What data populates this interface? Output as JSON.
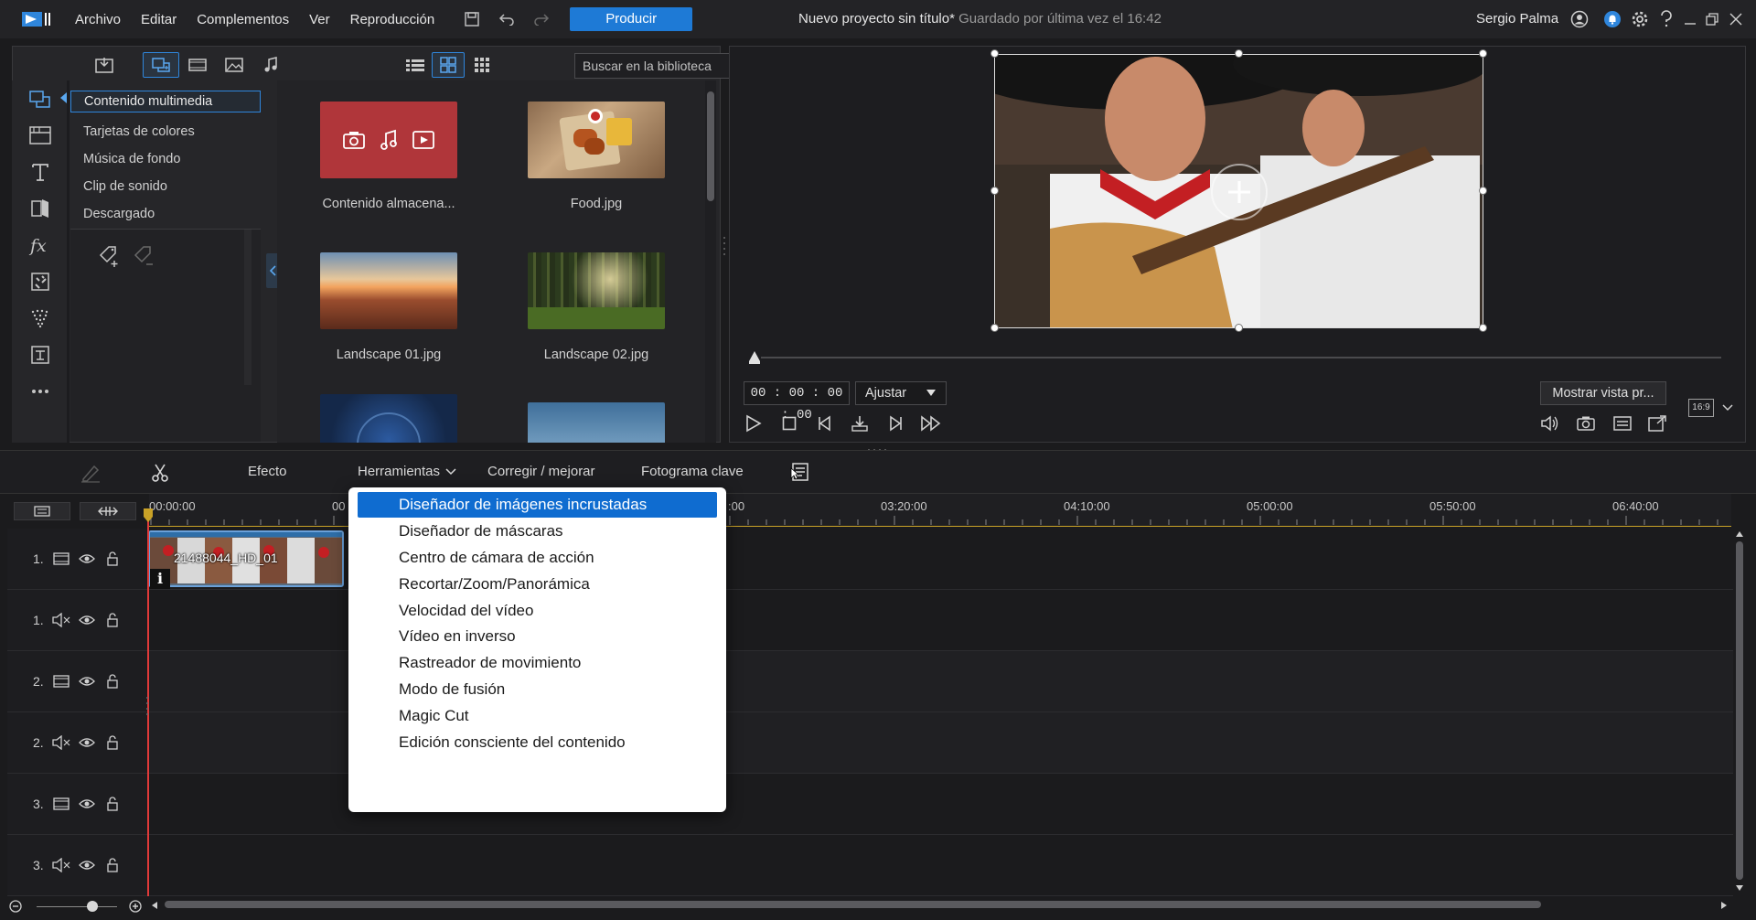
{
  "app": {
    "menu": [
      "Archivo",
      "Editar",
      "Complementos",
      "Ver",
      "Reproducción"
    ],
    "produce_label": "Producir",
    "project_title": "Nuevo proyecto sin título*",
    "saved_text": "Guardado por última vez el 16:42",
    "user_name": "Sergio Palma",
    "accent_color": "#1e7ad6"
  },
  "library": {
    "search_placeholder": "Buscar en la biblioteca",
    "categories": [
      "Contenido multimedia",
      "Tarjetas de colores",
      "Música de fondo",
      "Clip de sonido",
      "Descargado"
    ],
    "items": [
      {
        "label": "Contenido almacena...",
        "thumb": "stock-content"
      },
      {
        "label": "Food.jpg",
        "thumb": "food"
      },
      {
        "label": "Landscape 01.jpg",
        "thumb": "landscape-canyon"
      },
      {
        "label": "Landscape 02.jpg",
        "thumb": "landscape-forest"
      },
      {
        "label": "",
        "thumb": "audio"
      },
      {
        "label": "",
        "thumb": "landscape-sky"
      }
    ]
  },
  "preview": {
    "timecode": "00 : 00 : 00 : 00",
    "fit_option": "Ajustar",
    "show_preview_label": "Mostrar vista pr...",
    "aspect_ratio": "16:9"
  },
  "timeline_toolbar": {
    "effect": "Efecto",
    "tools": "Herramientas",
    "correct": "Corregir / mejorar",
    "keyframe": "Fotograma clave"
  },
  "ruler": {
    "labels": [
      "00:00:00",
      "00",
      ":00",
      "03:20:00",
      "04:10:00",
      "05:00:00",
      "05:50:00",
      "06:40:00"
    ]
  },
  "tracks": [
    {
      "num": "1.",
      "kind": "video"
    },
    {
      "num": "1.",
      "kind": "audio"
    },
    {
      "num": "2.",
      "kind": "video"
    },
    {
      "num": "2.",
      "kind": "audio"
    },
    {
      "num": "3.",
      "kind": "video"
    },
    {
      "num": "3.",
      "kind": "audio"
    }
  ],
  "clip": {
    "label": "21488044_HD_01"
  },
  "tools_menu": {
    "items": [
      "Diseñador de imágenes incrustadas",
      "Diseñador de máscaras",
      "Centro de cámara de acción",
      "Recortar/Zoom/Panorámica",
      "Velocidad del vídeo",
      "Vídeo en inverso",
      "Rastreador de movimiento",
      "Modo de fusión",
      "Magic Cut",
      "Edición consciente del contenido"
    ],
    "active_index": 0
  }
}
